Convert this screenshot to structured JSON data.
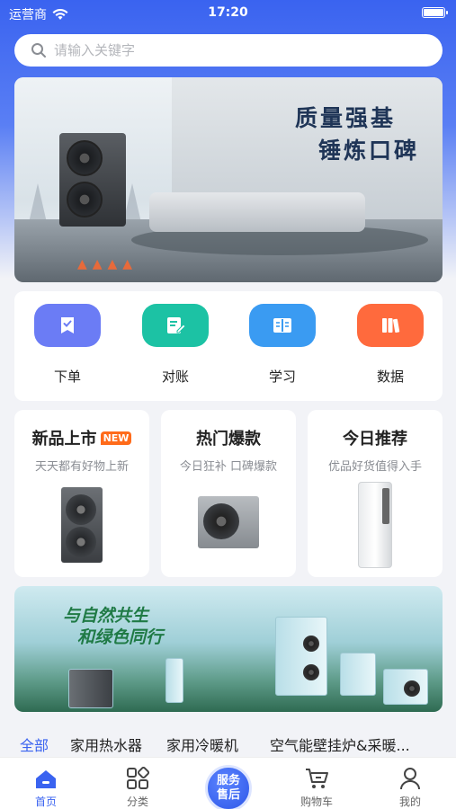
{
  "status_bar": {
    "carrier": "运营商",
    "time": "17:20"
  },
  "search": {
    "placeholder": "请输入关键字"
  },
  "banner_top": {
    "line1": "质量强基",
    "line2": "锤炼口碑"
  },
  "quick_actions": [
    {
      "label": "下单",
      "icon": "order-check-icon",
      "color": "#6b7cf5"
    },
    {
      "label": "对账",
      "icon": "edit-note-icon",
      "color": "#1cc2a4"
    },
    {
      "label": "学习",
      "icon": "book-icon",
      "color": "#3a9bf2"
    },
    {
      "label": "数据",
      "icon": "books-icon",
      "color": "#ff6a3d"
    }
  ],
  "cards": [
    {
      "title": "新品上市",
      "badge": "NEW",
      "subtitle": "天天都有好物上新"
    },
    {
      "title": "热门爆款",
      "subtitle": "今日狂补 口碑爆款"
    },
    {
      "title": "今日推荐",
      "subtitle": "优品好货值得入手"
    }
  ],
  "banner_bottom": {
    "line1": "与自然共生",
    "line2": "和绿色同行"
  },
  "category_tabs": [
    "全部",
    "家用热水器",
    "家用冷暖机",
    "空气能壁挂炉&采暖..."
  ],
  "bottom_nav": [
    {
      "label": "首页",
      "icon": "home-icon",
      "active": true
    },
    {
      "label": "分类",
      "icon": "category-grid-icon"
    },
    {
      "label": "服务\n售后",
      "icon": "service-center-button"
    },
    {
      "label": "购物车",
      "icon": "cart-icon"
    },
    {
      "label": "我的",
      "icon": "user-icon"
    }
  ],
  "service_button": {
    "line1": "服务",
    "line2": "售后"
  },
  "colors": {
    "primary": "#3a63f0",
    "badge": "#ff6b1a",
    "background": "#f2f3f7"
  }
}
